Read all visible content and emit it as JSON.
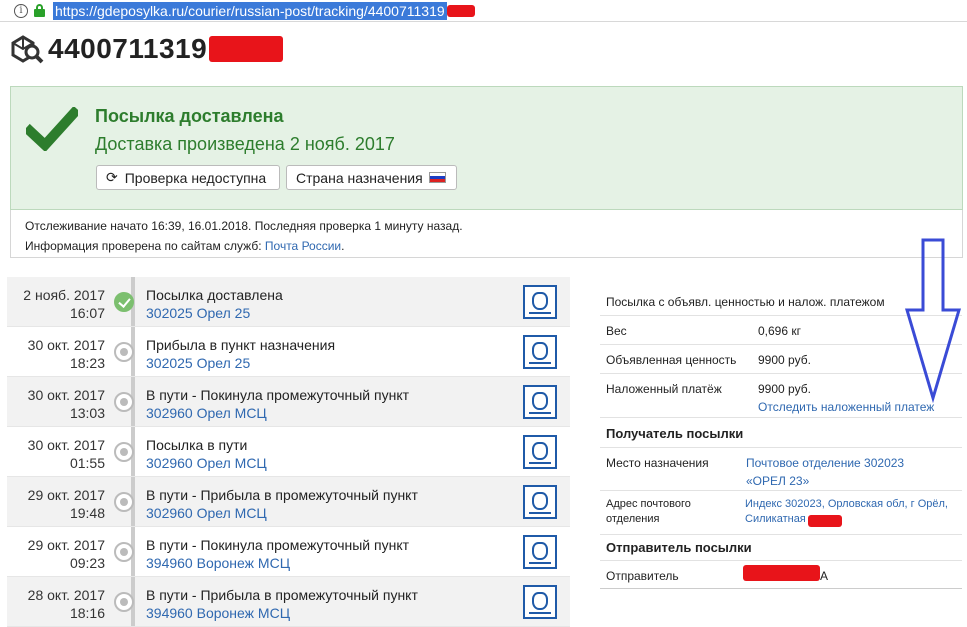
{
  "browser": {
    "url": "https://gdeposylka.ru/courier/russian-post/tracking/4400711319"
  },
  "header": {
    "tracking_number": "4400711319"
  },
  "status": {
    "title": "Посылка доставлена",
    "subtitle": "Доставка произведена 2 нояб. 2017",
    "refresh_label": "Проверка недоступна",
    "country_label": "Страна назначения"
  },
  "info": {
    "line1": "Отслеживание начато 16:39, 16.01.2018. Последняя проверка 1 минуту назад.",
    "line2_prefix": "Информация проверена по сайтам служб:",
    "line2_link": "Почта России",
    "line2_suffix": "."
  },
  "events": [
    {
      "date": "2 нояб. 2017",
      "time": "16:07",
      "title": "Посылка доставлена",
      "place": "302025 Орел 25"
    },
    {
      "date": "30 окт. 2017",
      "time": "18:23",
      "title": "Прибыла в пункт назначения",
      "place": "302025 Орел 25"
    },
    {
      "date": "30 окт. 2017",
      "time": "13:03",
      "title": "В пути - Покинула промежуточный пункт",
      "place": "302960 Орел МСЦ"
    },
    {
      "date": "30 окт. 2017",
      "time": "01:55",
      "title": "Посылка в пути",
      "place": "302960 Орел МСЦ"
    },
    {
      "date": "29 окт. 2017",
      "time": "19:48",
      "title": "В пути - Прибыла в промежуточный пункт",
      "place": "302960 Орел МСЦ"
    },
    {
      "date": "29 окт. 2017",
      "time": "09:23",
      "title": "В пути - Покинула промежуточный пункт",
      "place": "394960 Воронеж МСЦ"
    },
    {
      "date": "28 окт. 2017",
      "time": "18:16",
      "title": "В пути - Прибыла в промежуточный пункт",
      "place": "394960 Воронеж МСЦ"
    }
  ],
  "details": {
    "type": "Посылка с объявл. ценностью и налож. платежом",
    "weight_label": "Вес",
    "weight_value": "0,696 кг",
    "declared_label": "Объявленная ценность",
    "declared_value": "9900 руб.",
    "cod_label": "Наложенный платёж",
    "cod_value": "9900 руб.",
    "cod_link": "Отследить наложенный платеж",
    "recipient_header": "Получатель посылки",
    "dest_label": "Место назначения",
    "dest_value_line1": "Почтовое отделение 302023",
    "dest_value_line2": "«ОРЕЛ 23»",
    "address_label_line1": "Адрес почтового",
    "address_label_line2": "отделения",
    "address_value_line1": "Индекс 302023, Орловская обл, г Орёл,",
    "address_value_line2": "Силикатная",
    "sender_header": "Отправитель посылки",
    "sender_label": "Отправитель",
    "sender_value_suffix": "А"
  },
  "colors": {
    "accent_green": "#2d7d2d",
    "link_blue": "#2f68b0",
    "redaction": "#e8141a",
    "annotation_arrow": "#3a4bd6"
  }
}
